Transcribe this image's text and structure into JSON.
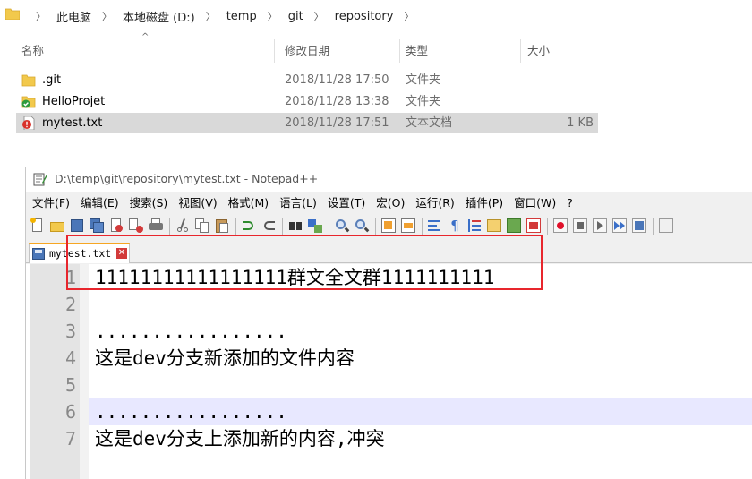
{
  "explorer": {
    "breadcrumb": [
      "此电脑",
      "本地磁盘 (D:)",
      "temp",
      "git",
      "repository"
    ],
    "columns": {
      "name": "名称",
      "date": "修改日期",
      "type": "类型",
      "size": "大小"
    },
    "files": [
      {
        "name": ".git",
        "date": "2018/11/28 17:50",
        "type": "文件夹",
        "size": "",
        "icon": "folder-icon"
      },
      {
        "name": "HelloProjet",
        "date": "2018/11/28 13:38",
        "type": "文件夹",
        "size": "",
        "icon": "folder-sync-icon"
      },
      {
        "name": "mytest.txt",
        "date": "2018/11/28 17:51",
        "type": "文本文档",
        "size": "1 KB",
        "icon": "text-file-conflict-icon"
      }
    ]
  },
  "notepad": {
    "title": "D:\\temp\\git\\repository\\mytest.txt - Notepad++",
    "menu": [
      "文件(F)",
      "编辑(E)",
      "搜索(S)",
      "视图(V)",
      "格式(M)",
      "语言(L)",
      "设置(T)",
      "宏(O)",
      "运行(R)",
      "插件(P)",
      "窗口(W)",
      "?"
    ],
    "tab": {
      "label": "mytest.txt"
    },
    "lines": [
      {
        "num": "1",
        "text": "11111111111111111群文全文群1111111111"
      },
      {
        "num": "2",
        "text": ""
      },
      {
        "num": "3",
        "text": "................."
      },
      {
        "num": "4",
        "text": "这是dev分支新添加的文件内容"
      },
      {
        "num": "5",
        "text": ""
      },
      {
        "num": "6",
        "text": "................."
      },
      {
        "num": "7",
        "text": "这是dev分支上添加新的内容,冲突"
      }
    ]
  },
  "colors": {
    "selected_row": "#d9d9d9",
    "current_line": "#e8e8ff",
    "highlight_box": "#e8262d",
    "tab_accent": "#f6a623"
  }
}
